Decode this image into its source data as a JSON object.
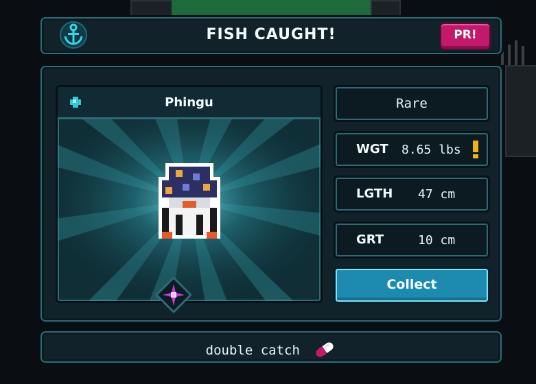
{
  "header": {
    "title": "FISH CAUGHT!",
    "badge": "PR!",
    "icon": "anchor-icon"
  },
  "fish": {
    "name": "Phingu",
    "rarity": "Rare",
    "rarity_icon": "gem-icon",
    "bait_icon": "star-icon"
  },
  "stats": {
    "weight": {
      "label": "WGT",
      "value": "8.65 lbs",
      "flag": "exclamation-icon"
    },
    "length": {
      "label": "LGTH",
      "value": "47 cm"
    },
    "girth": {
      "label": "GRT",
      "value": "10 cm"
    }
  },
  "actions": {
    "collect_label": "Collect"
  },
  "footer": {
    "text": "double catch",
    "icon": "capsule-icon"
  },
  "colors": {
    "accent": "#2f6a74",
    "button": "#1d8bb0",
    "badge": "#c2196b",
    "warning": "#f4b21a"
  }
}
